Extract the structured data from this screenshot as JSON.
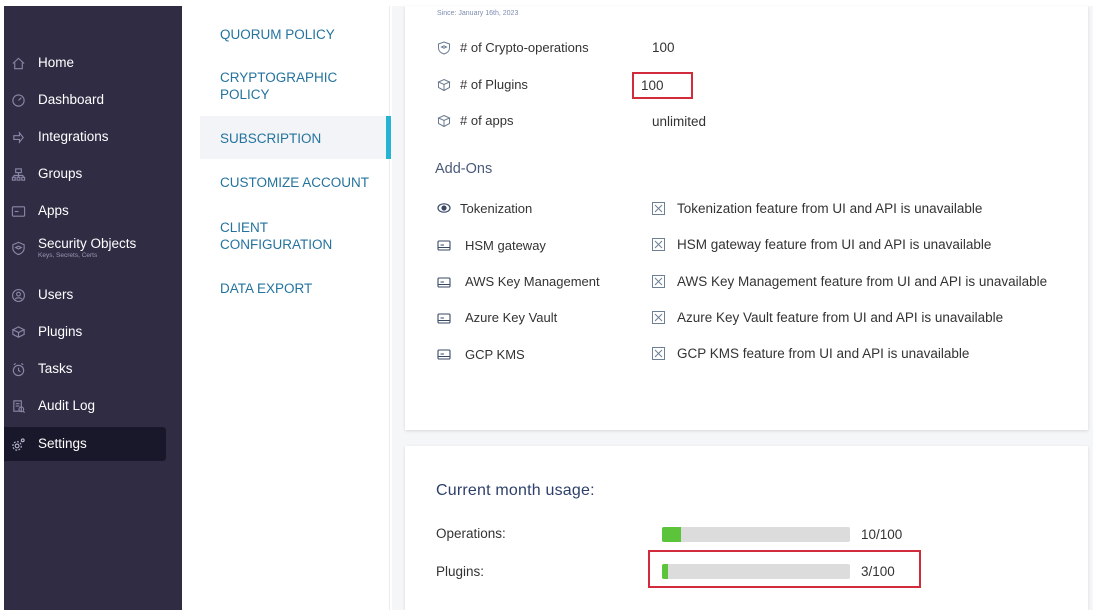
{
  "nav": {
    "items": [
      {
        "label": "Home",
        "sub": "",
        "icon": "home-icon"
      },
      {
        "label": "Dashboard",
        "sub": "",
        "icon": "dashboard-icon"
      },
      {
        "label": "Integrations",
        "sub": "",
        "icon": "integrations-icon"
      },
      {
        "label": "Groups",
        "sub": "",
        "icon": "groups-icon"
      },
      {
        "label": "Apps",
        "sub": "",
        "icon": "apps-icon"
      },
      {
        "label": "Security Objects",
        "sub": "Keys, Secrets, Certs",
        "icon": "security-objects-icon"
      },
      {
        "label": "Users",
        "sub": "",
        "icon": "users-icon"
      },
      {
        "label": "Plugins",
        "sub": "",
        "icon": "plugins-icon"
      },
      {
        "label": "Tasks",
        "sub": "",
        "icon": "tasks-icon"
      },
      {
        "label": "Audit Log",
        "sub": "",
        "icon": "audit-log-icon"
      },
      {
        "label": "Settings",
        "sub": "",
        "icon": "settings-icon"
      }
    ],
    "active": "Settings"
  },
  "settings_nav": {
    "items": [
      "QUORUM POLICY",
      "CRYPTOGRAPHIC POLICY",
      "SUBSCRIPTION",
      "CUSTOMIZE ACCOUNT",
      "CLIENT CONFIGURATION",
      "DATA EXPORT"
    ],
    "active": "SUBSCRIPTION"
  },
  "subscription": {
    "since": "Since: January 16th, 2023",
    "limits": [
      {
        "label": "# of Crypto-operations",
        "value": "100",
        "icon": "shield-cube-icon"
      },
      {
        "label": "# of Plugins",
        "value": "100",
        "icon": "cube-icon"
      },
      {
        "label": "# of apps",
        "value": "unlimited",
        "icon": "cube-icon"
      }
    ],
    "addons_title": "Add-Ons",
    "addons": [
      {
        "label": "Tokenization",
        "desc": "Tokenization feature from UI and API is unavailable",
        "icon": "eye-icon"
      },
      {
        "label": "HSM gateway",
        "desc": "HSM gateway feature from UI and API is unavailable",
        "icon": "gateway-icon"
      },
      {
        "label": "AWS Key Management",
        "desc": "AWS Key Management feature from UI and API is unavailable",
        "icon": "gateway-icon"
      },
      {
        "label": "Azure Key Vault",
        "desc": "Azure Key Vault feature from UI and API is unavailable",
        "icon": "gateway-icon"
      },
      {
        "label": "GCP KMS",
        "desc": "GCP KMS feature from UI and API is unavailable",
        "icon": "gateway-icon"
      }
    ]
  },
  "usage": {
    "title": "Current month usage:",
    "rows": [
      {
        "label": "Operations:",
        "count": "10/100",
        "fraction": 0.1
      },
      {
        "label": "Plugins:",
        "count": "3/100",
        "fraction": 0.03
      }
    ]
  },
  "colors": {
    "sidebar": "#2f2c44",
    "accent": "#25b3d4",
    "link": "#24739e",
    "progress": "#5cc43a",
    "highlight": "#d12b3c"
  }
}
